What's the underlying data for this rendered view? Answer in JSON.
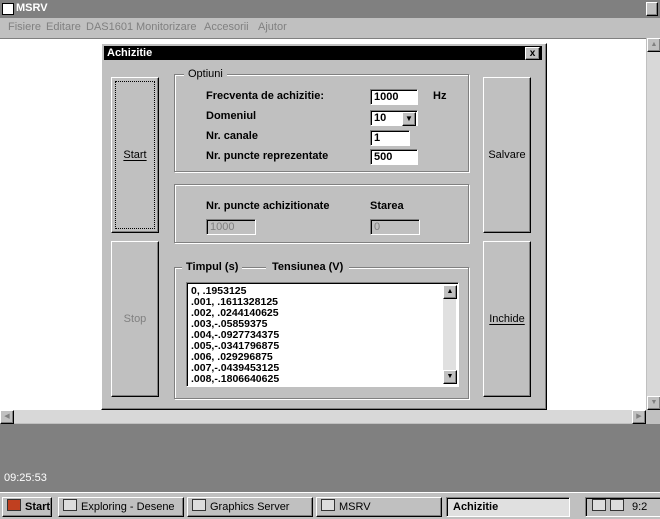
{
  "app": {
    "title": "MSRV",
    "menu": [
      "Fisiere",
      "Editare",
      "DAS1601",
      "Monitorizare",
      "Accesorii",
      "Ajutor"
    ],
    "log_time": "09:25:53"
  },
  "dialog": {
    "title": "Achizitie",
    "close": "x",
    "buttons": {
      "start": "Start",
      "stop": "Stop",
      "save": "Salvare",
      "close": "Inchide"
    },
    "options": {
      "group_label": "Optiuni",
      "frequency_label": "Frecventa de achizitie:",
      "frequency_value": "1000",
      "frequency_unit": "Hz",
      "domain_label": "Domeniul",
      "domain_value": "10",
      "channels_label": "Nr. canale",
      "channels_value": "1",
      "points_label": "Nr. puncte reprezentate",
      "points_value": "500"
    },
    "status": {
      "acquired_label": "Nr. puncte achizitionate",
      "acquired_value": "1000",
      "state_label": "Starea",
      "state_value": "0"
    },
    "data": {
      "time_header": "Timpul (s)",
      "voltage_header": "Tensiunea (V)",
      "rows": [
        "0, .1953125",
        ".001, .1611328125",
        ".002, .0244140625",
        ".003,-.05859375",
        ".004,-.0927734375",
        ".005,-.0341796875",
        ".006, .029296875",
        ".007,-.0439453125",
        ".008,-.1806640625"
      ]
    }
  },
  "taskbar": {
    "start": "Start",
    "tasks": [
      "Exploring - Desene",
      "Graphics Server",
      "MSRV",
      "Achizitie"
    ],
    "clock": "9:2"
  }
}
